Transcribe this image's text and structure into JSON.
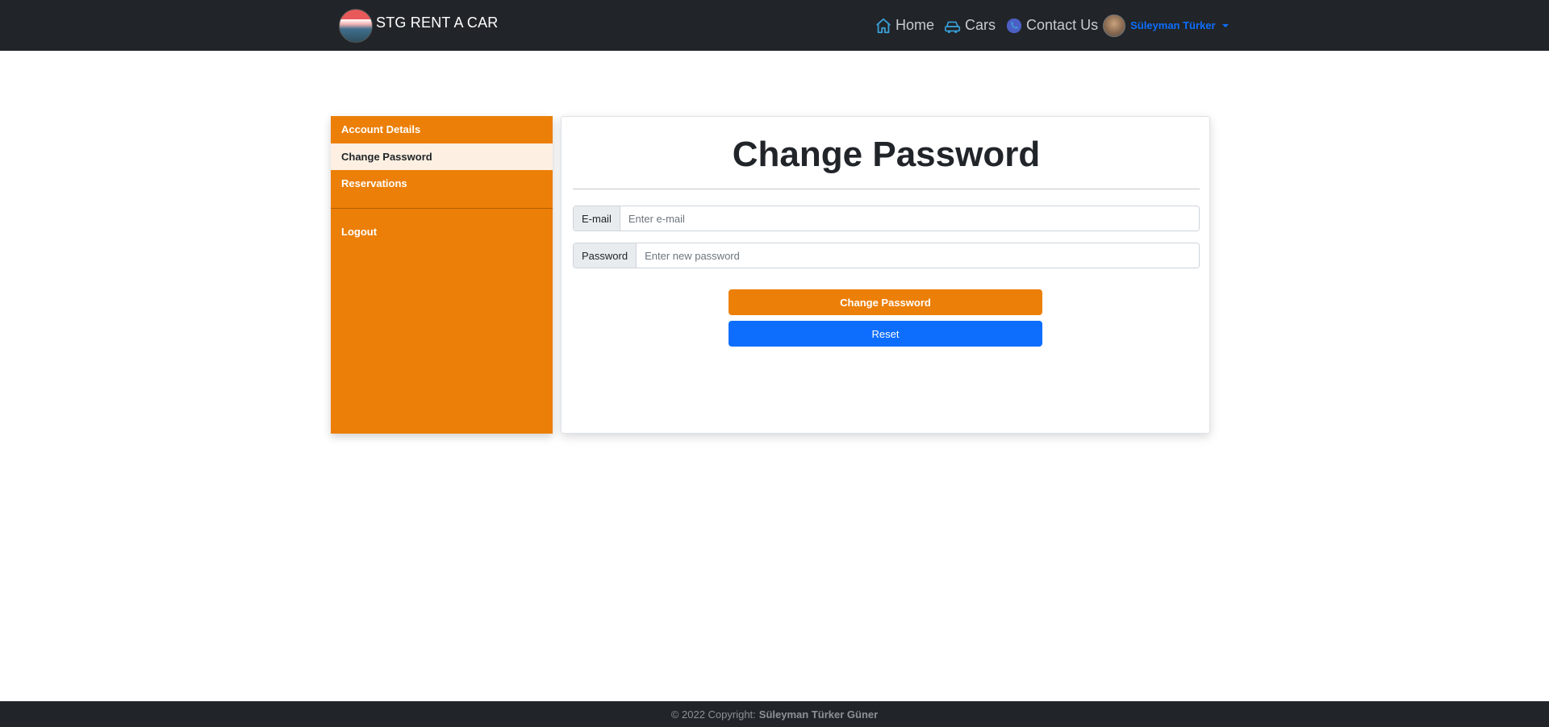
{
  "navbar": {
    "brand": "STG RENT A CAR",
    "brand_logo_icon": "car-logo-icon",
    "links": [
      {
        "label": "Home",
        "icon": "home-icon"
      },
      {
        "label": "Cars",
        "icon": "car-icon"
      },
      {
        "label": "Contact Us",
        "icon": "phone-icon"
      }
    ],
    "user": {
      "name": "Süleyman Türker",
      "icon": "chevron-down-icon"
    }
  },
  "sidebar": {
    "items": [
      {
        "label": "Account Details",
        "active": false
      },
      {
        "label": "Change Password",
        "active": true
      },
      {
        "label": "Reservations",
        "active": false
      },
      {
        "label": "Logout",
        "active": false
      }
    ]
  },
  "form": {
    "title": "Change Password",
    "email": {
      "label": "E-mail",
      "placeholder": "Enter e-mail",
      "value": ""
    },
    "password": {
      "label": "Password",
      "placeholder": "Enter new password",
      "value": ""
    },
    "submit_label": "Change Password",
    "reset_label": "Reset"
  },
  "footer": {
    "copyright": "© 2022 Copyright:",
    "author": "Süleyman Türker Güner"
  },
  "colors": {
    "accent_orange": "#ec7f07",
    "primary_blue": "#0d6efd",
    "navbar_dark": "#212529"
  }
}
